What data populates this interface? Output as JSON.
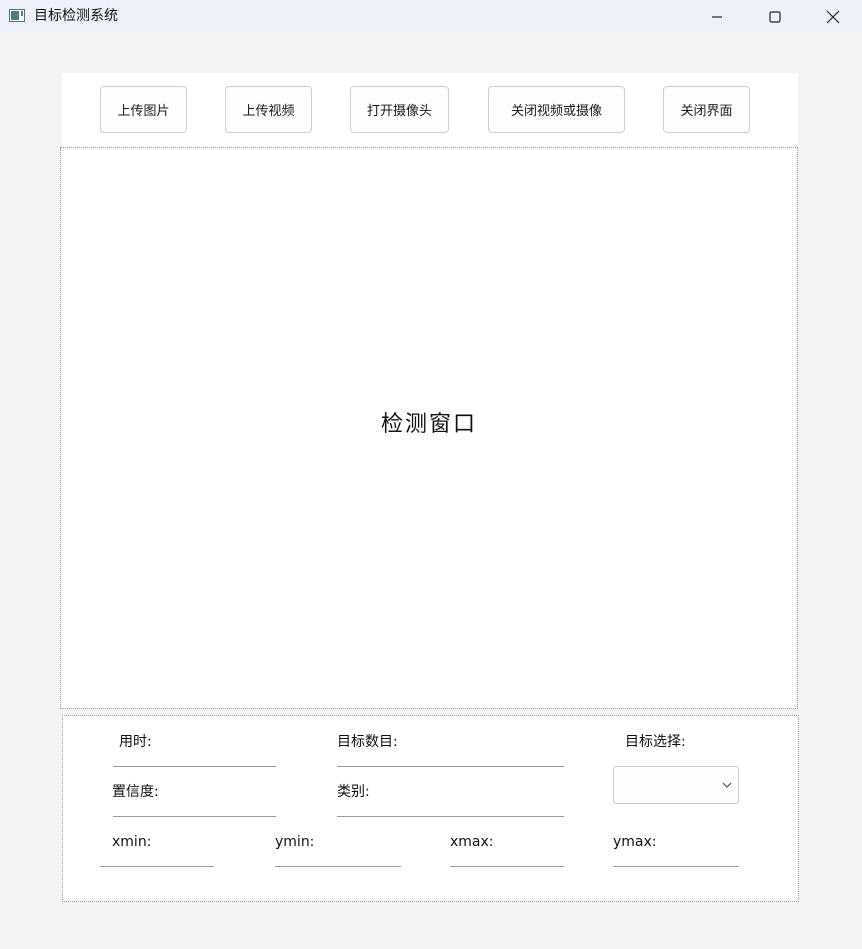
{
  "window": {
    "title": "目标检测系统",
    "controls": [
      "minimize-icon",
      "maximize-icon",
      "close-icon"
    ]
  },
  "toolbar": {
    "upload_image": "上传图片",
    "upload_video": "上传视频",
    "open_camera": "打开摄像头",
    "close_video_camera": "关闭视频或摄像",
    "close_ui": "关闭界面"
  },
  "detection": {
    "placeholder": "检测窗口"
  },
  "info": {
    "time_label": "用时:",
    "time_value": "",
    "count_label": "目标数目:",
    "count_value": "",
    "select_label": "目标选择:",
    "select_value": "",
    "confidence_label": "置信度:",
    "confidence_value": "",
    "class_label": "类别:",
    "class_value": "",
    "xmin_label": "xmin:",
    "xmin_value": "",
    "ymin_label": "ymin:",
    "ymin_value": "",
    "xmax_label": "xmax:",
    "xmax_value": "",
    "ymax_label": "ymax:",
    "ymax_value": ""
  },
  "colors": {
    "background": "#f3f3f3",
    "panel": "#ffffff",
    "titlebar": "#eef1f7",
    "border": "#9a9a9a"
  }
}
